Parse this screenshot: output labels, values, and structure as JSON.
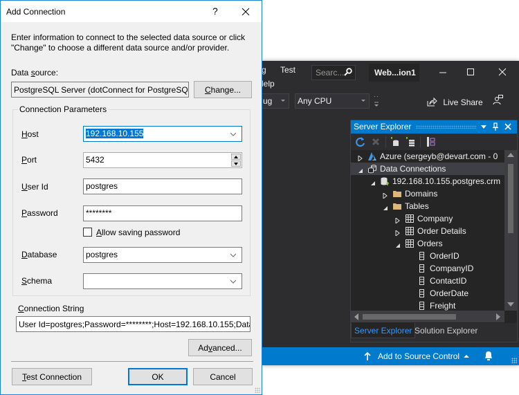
{
  "dialog": {
    "title": "Add Connection",
    "help_glyph": "?",
    "instructions_line1": "Enter information to connect to the selected data source or click",
    "instructions_line2": "\"Change\" to choose a different data source and/or provider.",
    "data_source": {
      "label_pre": "Data ",
      "label_accel": "s",
      "label_post": "ource:",
      "value": "PostgreSQL Server (dotConnect for PostgreSQL)",
      "change_accel": "C",
      "change_rest": "hange..."
    },
    "group_title": "Connection Parameters",
    "host": {
      "accel": "H",
      "rest": "ost",
      "value": "192.168.10.155"
    },
    "port": {
      "accel": "P",
      "rest": "ort",
      "value": "5432"
    },
    "user_id": {
      "accel": "U",
      "rest": "ser Id",
      "value": "postgres"
    },
    "password": {
      "accel": "P",
      "rest": "assword",
      "value": "********"
    },
    "allow_saving": {
      "accel": "A",
      "rest": "llow saving password",
      "checked": false
    },
    "database": {
      "accel": "D",
      "rest": "atabase",
      "value": "postgres"
    },
    "schema": {
      "accel": "S",
      "rest": "chema",
      "value": ""
    },
    "connection_string": {
      "accel": "C",
      "rest": "onnection String",
      "value": "User Id=postgres;Password=********;Host=192.168.10.155;Datab"
    },
    "advanced": {
      "pre": "Ad",
      "accel": "v",
      "post": "anced..."
    },
    "test_connection": {
      "accel": "T",
      "rest": "est Connection"
    },
    "ok": "OK",
    "cancel": "Cancel"
  },
  "vs": {
    "menu": [
      "g",
      "Test",
      "lelp"
    ],
    "search_placeholder": "Searc...",
    "solution_title": "Web...ion1",
    "config_combo": "ug",
    "platform_combo": "Any CPU",
    "live_share": "Live Share",
    "server_explorer": {
      "title": "Server Explorer",
      "tree": [
        {
          "label": "Azure (sergeyb@devart.com - 0",
          "level": 0,
          "expander": "collapsed",
          "icon": "azure-icon"
        },
        {
          "label": "Data Connections",
          "level": 0,
          "expander": "expanded",
          "icon": "data-connections-icon",
          "selected": true
        },
        {
          "label": "192.168.10.155.postgres.crm",
          "level": 1,
          "expander": "expanded",
          "icon": "database-connection-icon"
        },
        {
          "label": "Domains",
          "level": 2,
          "expander": "collapsed",
          "icon": "folder-icon"
        },
        {
          "label": "Tables",
          "level": 2,
          "expander": "expanded",
          "icon": "folder-icon"
        },
        {
          "label": "Company",
          "level": 3,
          "expander": "collapsed",
          "icon": "table-icon"
        },
        {
          "label": "Order Details",
          "level": 3,
          "expander": "collapsed",
          "icon": "table-icon"
        },
        {
          "label": "Orders",
          "level": 3,
          "expander": "expanded",
          "icon": "table-icon"
        },
        {
          "label": "OrderID",
          "level": 4,
          "expander": "none",
          "icon": "column-icon"
        },
        {
          "label": "CompanyID",
          "level": 4,
          "expander": "none",
          "icon": "column-icon"
        },
        {
          "label": "ContactID",
          "level": 4,
          "expander": "none",
          "icon": "column-icon"
        },
        {
          "label": "OrderDate",
          "level": 4,
          "expander": "none",
          "icon": "column-icon"
        },
        {
          "label": "Freight",
          "level": 4,
          "expander": "none",
          "icon": "column-icon"
        }
      ],
      "tabs": [
        "Server Explorer",
        "Solution Explorer"
      ]
    },
    "status_bar": {
      "source_control": "Add to Source Control"
    }
  },
  "colors": {
    "accent": "#0078d7",
    "vs_blue": "#007acc",
    "vs_dark": "#2d2d30",
    "folder": "#dcb67a"
  }
}
